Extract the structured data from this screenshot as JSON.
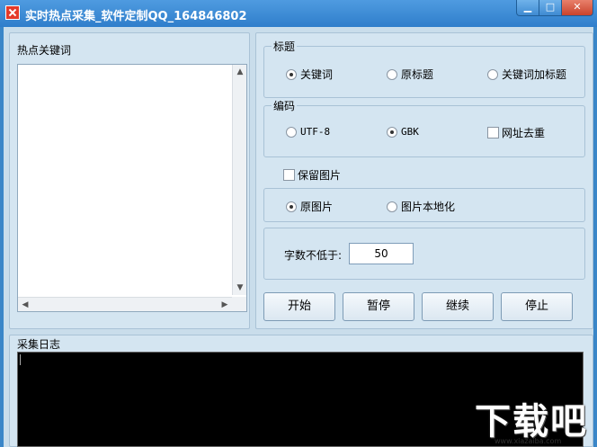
{
  "window": {
    "title": "实时热点采集_软件定制QQ_164846802",
    "min_label": "▁",
    "max_label": "□",
    "close_label": "✕"
  },
  "keywords": {
    "label": "热点关键词",
    "up_arrow": "▲",
    "down_arrow": "▼",
    "left_arrow": "◀",
    "right_arrow": "▶"
  },
  "title_group": {
    "legend": "标题",
    "options": [
      "关键词",
      "原标题",
      "关键词加标题"
    ],
    "selected": 0
  },
  "encoding_group": {
    "legend": "编码",
    "options": [
      "UTF-8",
      "GBK"
    ],
    "selected": 1,
    "dedup_label": "网址去重",
    "dedup_checked": false
  },
  "keep_images": {
    "label": "保留图片",
    "checked": false
  },
  "image_group": {
    "options": [
      "原图片",
      "图片本地化"
    ],
    "selected": 0
  },
  "word_count": {
    "label": "字数不低于:",
    "value": "50"
  },
  "actions": {
    "start": "开始",
    "pause": "暂停",
    "resume": "继续",
    "stop": "停止"
  },
  "log": {
    "label": "采集日志"
  },
  "watermark": {
    "text": "下载吧",
    "url": "www.xiazaiba.com"
  },
  "colors": {
    "titlebar": "#2f7ecb",
    "client_bg": "#c9ddeb",
    "log_bg": "#000000"
  }
}
